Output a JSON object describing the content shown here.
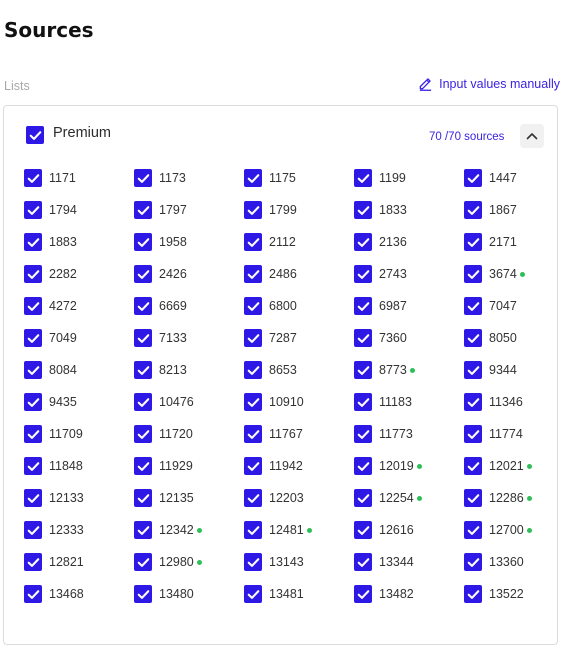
{
  "page": {
    "title": "Sources"
  },
  "lists": {
    "label": "Lists",
    "manual_link_label": "Input values manually"
  },
  "card": {
    "title": "Premium",
    "counter_text": "70 /70  sources",
    "checked": true
  },
  "colors": {
    "accent": "#2e18e6",
    "link": "#3b23e0",
    "status_dot": "#2fbf59"
  },
  "sources": [
    {
      "id": "1171",
      "dot": false
    },
    {
      "id": "1173",
      "dot": false
    },
    {
      "id": "1175",
      "dot": false
    },
    {
      "id": "1199",
      "dot": false
    },
    {
      "id": "1447",
      "dot": false
    },
    {
      "id": "1794",
      "dot": false
    },
    {
      "id": "1797",
      "dot": false
    },
    {
      "id": "1799",
      "dot": false
    },
    {
      "id": "1833",
      "dot": false
    },
    {
      "id": "1867",
      "dot": false
    },
    {
      "id": "1883",
      "dot": false
    },
    {
      "id": "1958",
      "dot": false
    },
    {
      "id": "2112",
      "dot": false
    },
    {
      "id": "2136",
      "dot": false
    },
    {
      "id": "2171",
      "dot": false
    },
    {
      "id": "2282",
      "dot": false
    },
    {
      "id": "2426",
      "dot": false
    },
    {
      "id": "2486",
      "dot": false
    },
    {
      "id": "2743",
      "dot": false
    },
    {
      "id": "3674",
      "dot": true
    },
    {
      "id": "4272",
      "dot": false
    },
    {
      "id": "6669",
      "dot": false
    },
    {
      "id": "6800",
      "dot": false
    },
    {
      "id": "6987",
      "dot": false
    },
    {
      "id": "7047",
      "dot": false
    },
    {
      "id": "7049",
      "dot": false
    },
    {
      "id": "7133",
      "dot": false
    },
    {
      "id": "7287",
      "dot": false
    },
    {
      "id": "7360",
      "dot": false
    },
    {
      "id": "8050",
      "dot": false
    },
    {
      "id": "8084",
      "dot": false
    },
    {
      "id": "8213",
      "dot": false
    },
    {
      "id": "8653",
      "dot": false
    },
    {
      "id": "8773",
      "dot": true
    },
    {
      "id": "9344",
      "dot": false
    },
    {
      "id": "9435",
      "dot": false
    },
    {
      "id": "10476",
      "dot": false
    },
    {
      "id": "10910",
      "dot": false
    },
    {
      "id": "11183",
      "dot": false
    },
    {
      "id": "11346",
      "dot": false
    },
    {
      "id": "11709",
      "dot": false
    },
    {
      "id": "11720",
      "dot": false
    },
    {
      "id": "11767",
      "dot": false
    },
    {
      "id": "11773",
      "dot": false
    },
    {
      "id": "11774",
      "dot": false
    },
    {
      "id": "11848",
      "dot": false
    },
    {
      "id": "11929",
      "dot": false
    },
    {
      "id": "11942",
      "dot": false
    },
    {
      "id": "12019",
      "dot": true
    },
    {
      "id": "12021",
      "dot": true
    },
    {
      "id": "12133",
      "dot": false
    },
    {
      "id": "12135",
      "dot": false
    },
    {
      "id": "12203",
      "dot": false
    },
    {
      "id": "12254",
      "dot": true
    },
    {
      "id": "12286",
      "dot": true
    },
    {
      "id": "12333",
      "dot": false
    },
    {
      "id": "12342",
      "dot": true
    },
    {
      "id": "12481",
      "dot": true
    },
    {
      "id": "12616",
      "dot": false
    },
    {
      "id": "12700",
      "dot": true
    },
    {
      "id": "12821",
      "dot": false
    },
    {
      "id": "12980",
      "dot": true
    },
    {
      "id": "13143",
      "dot": false
    },
    {
      "id": "13344",
      "dot": false
    },
    {
      "id": "13360",
      "dot": false
    },
    {
      "id": "13468",
      "dot": false
    },
    {
      "id": "13480",
      "dot": false
    },
    {
      "id": "13481",
      "dot": false
    },
    {
      "id": "13482",
      "dot": false
    },
    {
      "id": "13522",
      "dot": false
    }
  ]
}
